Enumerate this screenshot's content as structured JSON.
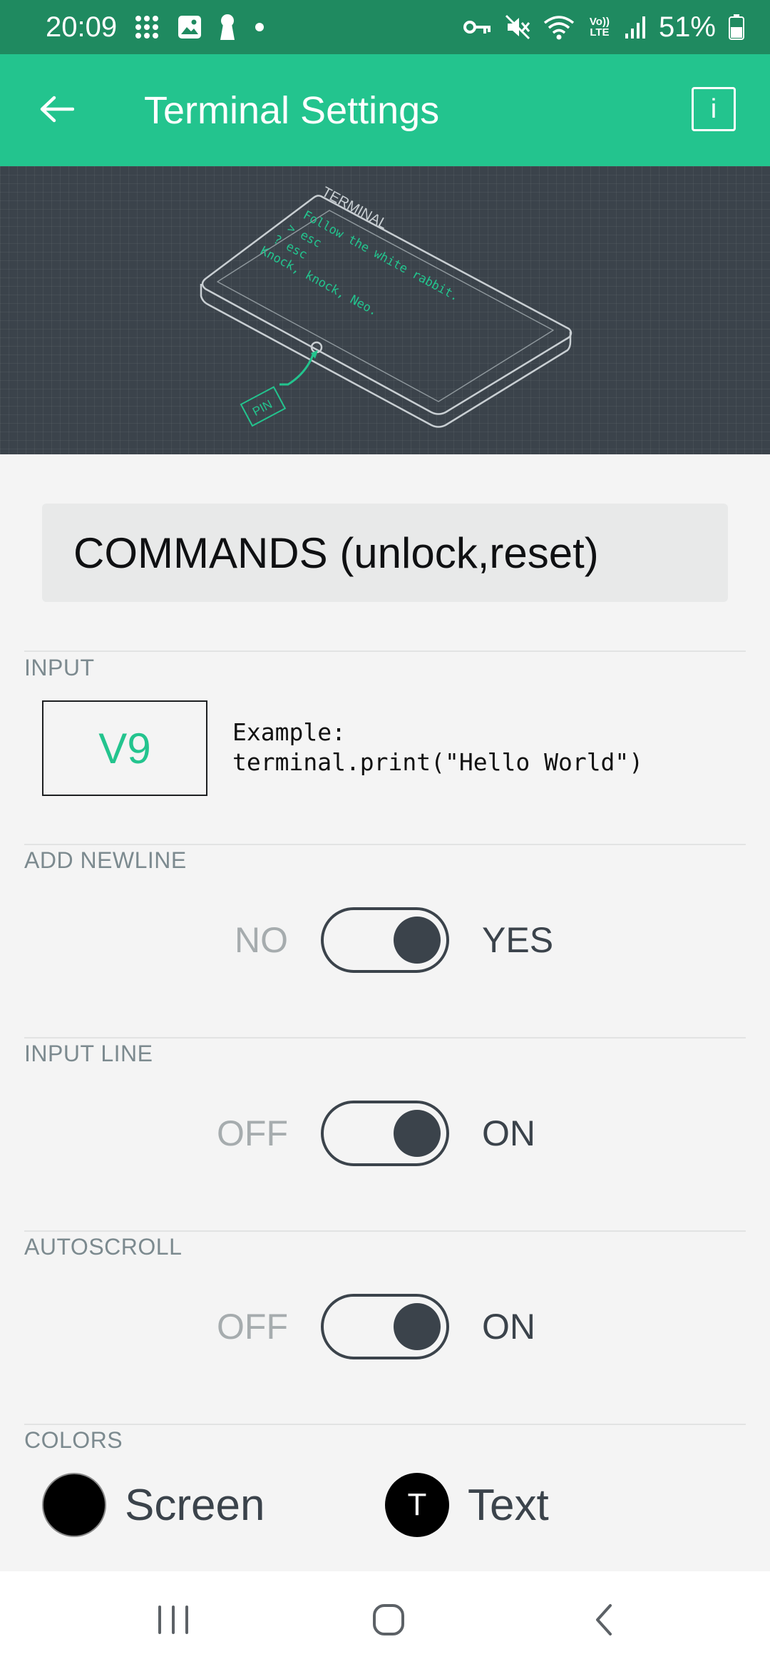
{
  "status_bar": {
    "time": "20:09",
    "battery": "51%",
    "network": "Vo)) LTE"
  },
  "app_bar": {
    "title": "Terminal Settings",
    "back_icon": "arrow-left-icon",
    "info_label": "i"
  },
  "illustration": {
    "device_label": "TERMINAL",
    "lines": [
      "Follow the white rabbit.",
      "> esc",
      "? esc",
      "Knock, knock, Neo."
    ],
    "pin_label": "PIN"
  },
  "name_field": {
    "value": "COMMANDS (unlock,reset)"
  },
  "input_section": {
    "label": "INPUT",
    "pin_value": "V9",
    "example_line1": "Example:",
    "example_line2": "terminal.print(\"Hello World\")"
  },
  "add_newline": {
    "label": "ADD NEWLINE",
    "off_label": "NO",
    "on_label": "YES",
    "state": true
  },
  "input_line": {
    "label": "INPUT LINE",
    "off_label": "OFF",
    "on_label": "ON",
    "state": true
  },
  "autoscroll": {
    "label": "AUTOSCROLL",
    "off_label": "OFF",
    "on_label": "ON",
    "state": true
  },
  "colors": {
    "label": "COLORS",
    "screen_label": "Screen",
    "screen_color": "#000000",
    "text_label": "Text",
    "text_swatch_letter": "T",
    "text_color": "#000000"
  },
  "theme": {
    "status_bar_color": "#1f8a60",
    "accent": "#23c48e",
    "dark": "#3b434b"
  }
}
